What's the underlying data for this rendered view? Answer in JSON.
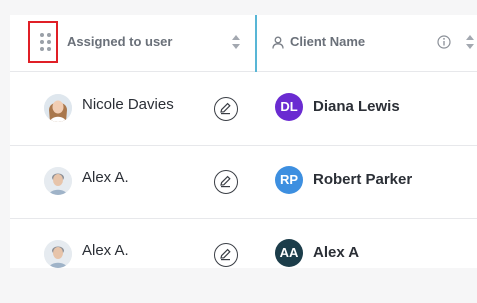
{
  "header": {
    "assigned_label": "Assigned to user",
    "client_label": "Client Name"
  },
  "icons": {
    "drag": "drag-handle-icon",
    "sort": "sort-icon",
    "person": "person-icon",
    "info": "info-icon",
    "edit": "pencil-icon"
  },
  "rows": [
    {
      "user": "Nicole Davies",
      "client_initials": "DL",
      "client_name": "Diana Lewis",
      "client_color": "#6a2bd1"
    },
    {
      "user": "Alex A.",
      "client_initials": "RP",
      "client_name": "Robert Parker",
      "client_color": "#3d8fe0"
    },
    {
      "user": "Alex A.",
      "client_initials": "AA",
      "client_name": "Alex A",
      "client_color": "#1c3d4a"
    }
  ]
}
